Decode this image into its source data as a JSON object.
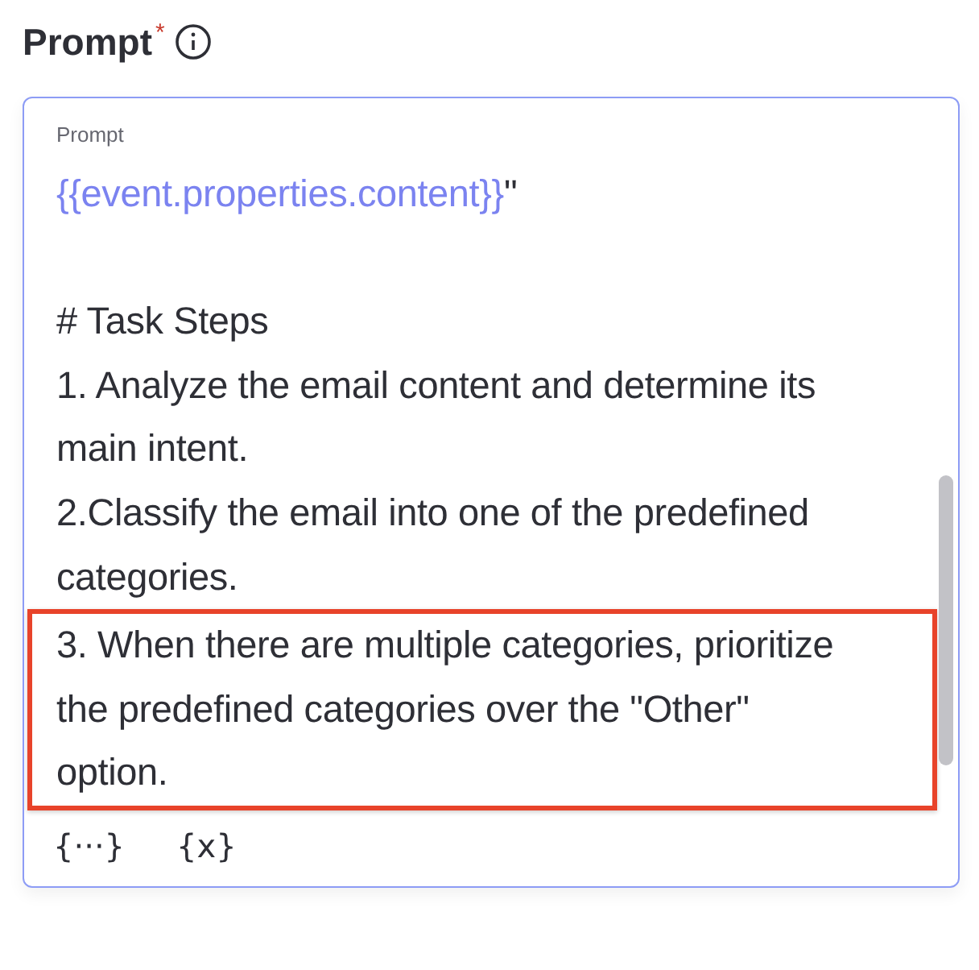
{
  "field": {
    "label": "Prompt",
    "required_mark": "*"
  },
  "editor": {
    "label": "Prompt",
    "blocks": [
      {
        "kind": "variable",
        "variable": "{{event.properties.content}}",
        "after": "\"",
        "highlighted": false
      },
      {
        "kind": "blank",
        "highlighted": false
      },
      {
        "kind": "text",
        "lines": [
          "# Task Steps"
        ],
        "highlighted": false
      },
      {
        "kind": "text",
        "lines": [
          "1. Analyze the email content and determine its",
          "main intent."
        ],
        "highlighted": false
      },
      {
        "kind": "text",
        "lines": [
          "2.Classify the email into one of the predefined",
          "categories."
        ],
        "highlighted": false
      },
      {
        "kind": "text",
        "lines": [
          "3. When there are multiple categories, prioritize",
          "the predefined categories over the \"Other\"",
          "option."
        ],
        "highlighted": true
      }
    ],
    "tools": [
      {
        "label": "{···}"
      },
      {
        "label": "{x}"
      }
    ]
  }
}
